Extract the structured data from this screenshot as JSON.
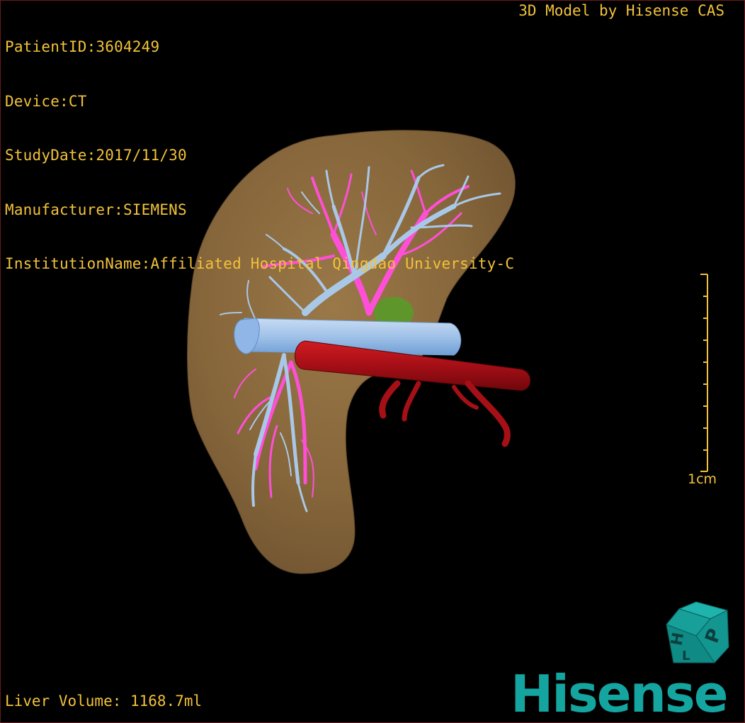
{
  "header": {
    "patient_id": "PatientID:3604249",
    "device": "Device:CT",
    "study_date": "StudyDate:2017/11/30",
    "manufacturer": "Manufacturer:SIEMENS",
    "institution": "InstitutionName:Affiliated Hospital Qingdao University-C"
  },
  "credit": "3D Model by Hisense CAS",
  "footer": {
    "liver_volume": "Liver Volume: 1168.7ml"
  },
  "scale_bar": {
    "label": "1cm"
  },
  "orientation_cube": {
    "visible_faces": [
      "H",
      "P",
      "L"
    ]
  },
  "brand": {
    "name": "Hisense"
  },
  "colors": {
    "text": "#f2c23a",
    "liver": "#8a6a3e",
    "portal_vein": "#a9c8e8",
    "hepatic_vein": "#ff4fd8",
    "vena_cava": "#8fbcea",
    "aorta": "#b0101a",
    "gallbladder": "#5a9a2a",
    "brand": "#14a5a0"
  }
}
